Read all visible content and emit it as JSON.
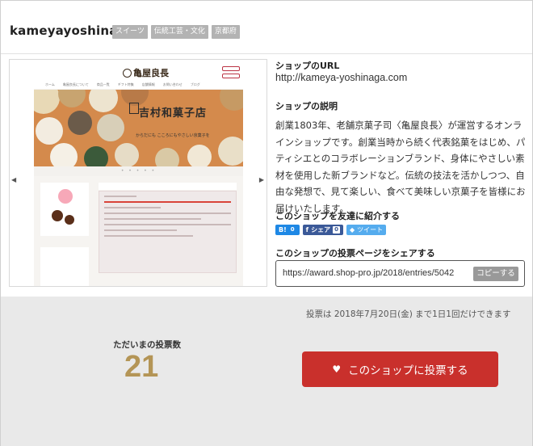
{
  "shop": {
    "name": "kameyayoshinaga",
    "tags": [
      "スイーツ",
      "伝統工芸・文化",
      "京都府"
    ]
  },
  "preview": {
    "site_logo": "亀屋良長",
    "hero_title": "吉村和菓子店",
    "hero_sub": "からだにも こころにもやさしい京菓子を",
    "nav": [
      "ホーム",
      "亀屋良長について",
      "商品一覧",
      "ギフト特集",
      "店舗情報",
      "お問い合わせ",
      "ブログ"
    ]
  },
  "info": {
    "url_label": "ショップのURL",
    "url": "http://kameya-yoshinaga.com",
    "desc_label": "ショップの説明",
    "desc": "創業1803年、老舗京菓子司〈亀屋良長〉が運営するオンラインショップです。創業当時から続く代表銘菓をはじめ、パティシエとのコラボレーションブランド、身体にやさしい素材を使用した新ブランドなど。伝統の技法を活かしつつ、自由な発想で、見て楽しい、食べて美味しい京菓子を皆様にお届けいたします。",
    "share_label": "このショップを友達に紹介する",
    "hatena_label": "B!",
    "hatena_count": "0",
    "fb_label": "シェア",
    "fb_count": "0",
    "tweet_label": "ツイート",
    "vote_share_label": "このショップの投票ページをシェアする",
    "vote_url": "https://award.shop-pro.jp/2018/entries/5042",
    "copy_label": "コピーする"
  },
  "vote": {
    "deadline": "投票は 2018年7月20日(金) まで1日1回だけできます",
    "count_label": "ただいまの投票数",
    "count": "21",
    "button_label": "このショップに投票する"
  },
  "colors": {
    "accent": "#c9302c",
    "count": "#b49556",
    "tag_bg": "#b3b3b3"
  }
}
